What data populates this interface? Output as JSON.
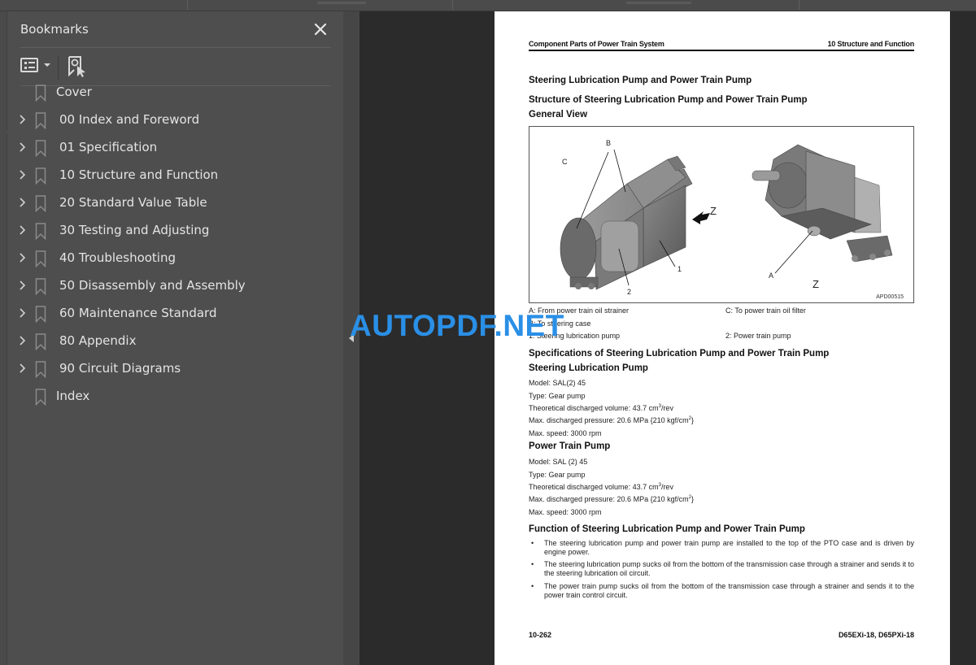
{
  "bookmarks_panel": {
    "title": "Bookmarks",
    "close_label": "✕",
    "options_icon": "list-options-icon",
    "new_bookmark_icon": "new-bookmark-icon",
    "items": [
      {
        "label": "Cover",
        "expandable": false
      },
      {
        "label": "00 Index and Foreword",
        "expandable": true
      },
      {
        "label": "01 Specification",
        "expandable": true
      },
      {
        "label": "10 Structure and Function",
        "expandable": true
      },
      {
        "label": "20 Standard Value Table",
        "expandable": true
      },
      {
        "label": "30 Testing and Adjusting",
        "expandable": true
      },
      {
        "label": "40 Troubleshooting",
        "expandable": true
      },
      {
        "label": "50 Disassembly and Assembly",
        "expandable": true
      },
      {
        "label": "60 Maintenance Standard",
        "expandable": true
      },
      {
        "label": "80 Appendix",
        "expandable": true
      },
      {
        "label": "90 Circuit Diagrams",
        "expandable": true
      },
      {
        "label": "Index",
        "expandable": false
      }
    ]
  },
  "watermark": "AUTOPDF.NET",
  "page": {
    "running_head_left": "Component Parts of Power Train System",
    "running_head_right": "10 Structure and Function",
    "title": "Steering Lubrication Pump and Power Train Pump",
    "structure_heading": "Structure of Steering Lubrication Pump and Power Train Pump",
    "general_view": "General View",
    "figure": {
      "ref": "APD00515",
      "labels": {
        "a": "A",
        "b": "B",
        "c": "C",
        "one": "1",
        "two": "2",
        "z_left": "Z",
        "z_right": "Z"
      }
    },
    "legend": {
      "a": "A: From power train oil strainer",
      "c": "C: To power train oil filter",
      "b": "B: To steering case",
      "one": "1: Steering lubrication pump",
      "two": "2: Power train pump"
    },
    "specs_heading": "Specifications of Steering Lubrication Pump and Power Train Pump",
    "steering_pump": {
      "heading": "Steering Lubrication Pump",
      "model": "Model: SAL(2) 45",
      "type": "Type: Gear pump",
      "volume": "Theoretical discharged volume: 43.7 cm",
      "volume_sup": "3",
      "volume_unit": "/rev",
      "pressure": "Max. discharged pressure: 20.6 MPa {210 kgf/cm",
      "pressure_sup": "2",
      "pressure_end": "}",
      "speed": "Max. speed: 3000 rpm"
    },
    "power_train_pump": {
      "heading": "Power Train Pump",
      "model": "Model: SAL (2) 45",
      "type": "Type: Gear pump",
      "volume": "Theoretical discharged volume: 43.7 cm",
      "volume_sup": "3",
      "volume_unit": "/rev",
      "pressure": "Max. discharged pressure: 20.6 MPa {210 kgf/cm",
      "pressure_sup": "2",
      "pressure_end": "}",
      "speed": "Max. speed: 3000 rpm"
    },
    "function_heading": "Function of Steering Lubrication Pump and Power Train Pump",
    "bullet_char": "•",
    "function_bullets": [
      "The steering lubrication pump and power train pump are installed to the top of the PTO case and is driven by engine power.",
      "The steering lubrication pump sucks oil from the bottom of the transmission case through a strainer and sends it to the steering lubrication oil circuit.",
      "The power train pump sucks oil from the bottom of the transmission case through a strainer and sends it to the power train control circuit."
    ],
    "footer_left": "10-262",
    "footer_right": "D65EXi-18, D65PXi-18"
  }
}
